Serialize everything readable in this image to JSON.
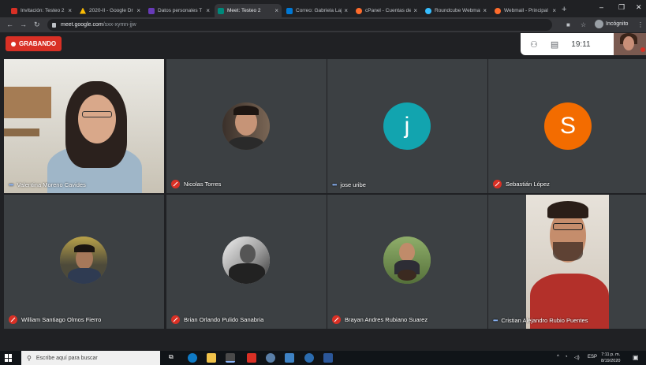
{
  "browser": {
    "tabs": [
      {
        "title": "Invitación: Testeo 2",
        "favicon": "gmail-icon",
        "color": "#d93025"
      },
      {
        "title": "2020-II - Google Dr",
        "favicon": "drive-icon",
        "color": "#fbbc04"
      },
      {
        "title": "Datos personales T",
        "favicon": "forms-icon",
        "color": "#673ab7"
      },
      {
        "title": "Meet: Testeo 2",
        "favicon": "meet-icon",
        "color": "#00897b",
        "active": true
      },
      {
        "title": "Correo: Gabriela Laj",
        "favicon": "outlook-icon",
        "color": "#0078d4"
      },
      {
        "title": "cPanel - Cuentas de",
        "favicon": "cpanel-icon",
        "color": "#ff6c2c"
      },
      {
        "title": "Roundcube Webmai",
        "favicon": "roundcube-icon",
        "color": "#37beff"
      },
      {
        "title": "Webmail - Principal",
        "favicon": "cpanel-icon",
        "color": "#ff6c2c"
      }
    ],
    "url_domain": "meet.google.com",
    "url_path": "/sxx-xymn-jjw",
    "incognito_label": "Incógnito"
  },
  "meet": {
    "recording_label": "GRABANDO",
    "clock": "19:11",
    "participants": [
      {
        "name": "Valentina Moreno Cavides",
        "mic": "speaking",
        "kind": "video"
      },
      {
        "name": "Nicolas Torres",
        "mic": "off",
        "kind": "photo"
      },
      {
        "name": "jose uribe",
        "mic": "speaking",
        "kind": "letter",
        "letter": "j",
        "color": "#12a4af"
      },
      {
        "name": "Sebastián López",
        "mic": "off",
        "kind": "letter",
        "letter": "S",
        "color": "#f36c00"
      },
      {
        "name": "William Santiago Olmos Fierro",
        "mic": "off",
        "kind": "photo"
      },
      {
        "name": "Brian Orlando Pulido Sanabria",
        "mic": "off",
        "kind": "photo"
      },
      {
        "name": "Brayan Andres Rubiano Suarez",
        "mic": "off",
        "kind": "photo"
      },
      {
        "name": "Cristian Alejandro Rubio Puentes",
        "mic": "speaking",
        "kind": "video"
      }
    ]
  },
  "taskbar": {
    "search_placeholder": "Escribe aquí para buscar",
    "lang": "ESP",
    "time": "7:11 p. m.",
    "date": "8/19/2020"
  }
}
